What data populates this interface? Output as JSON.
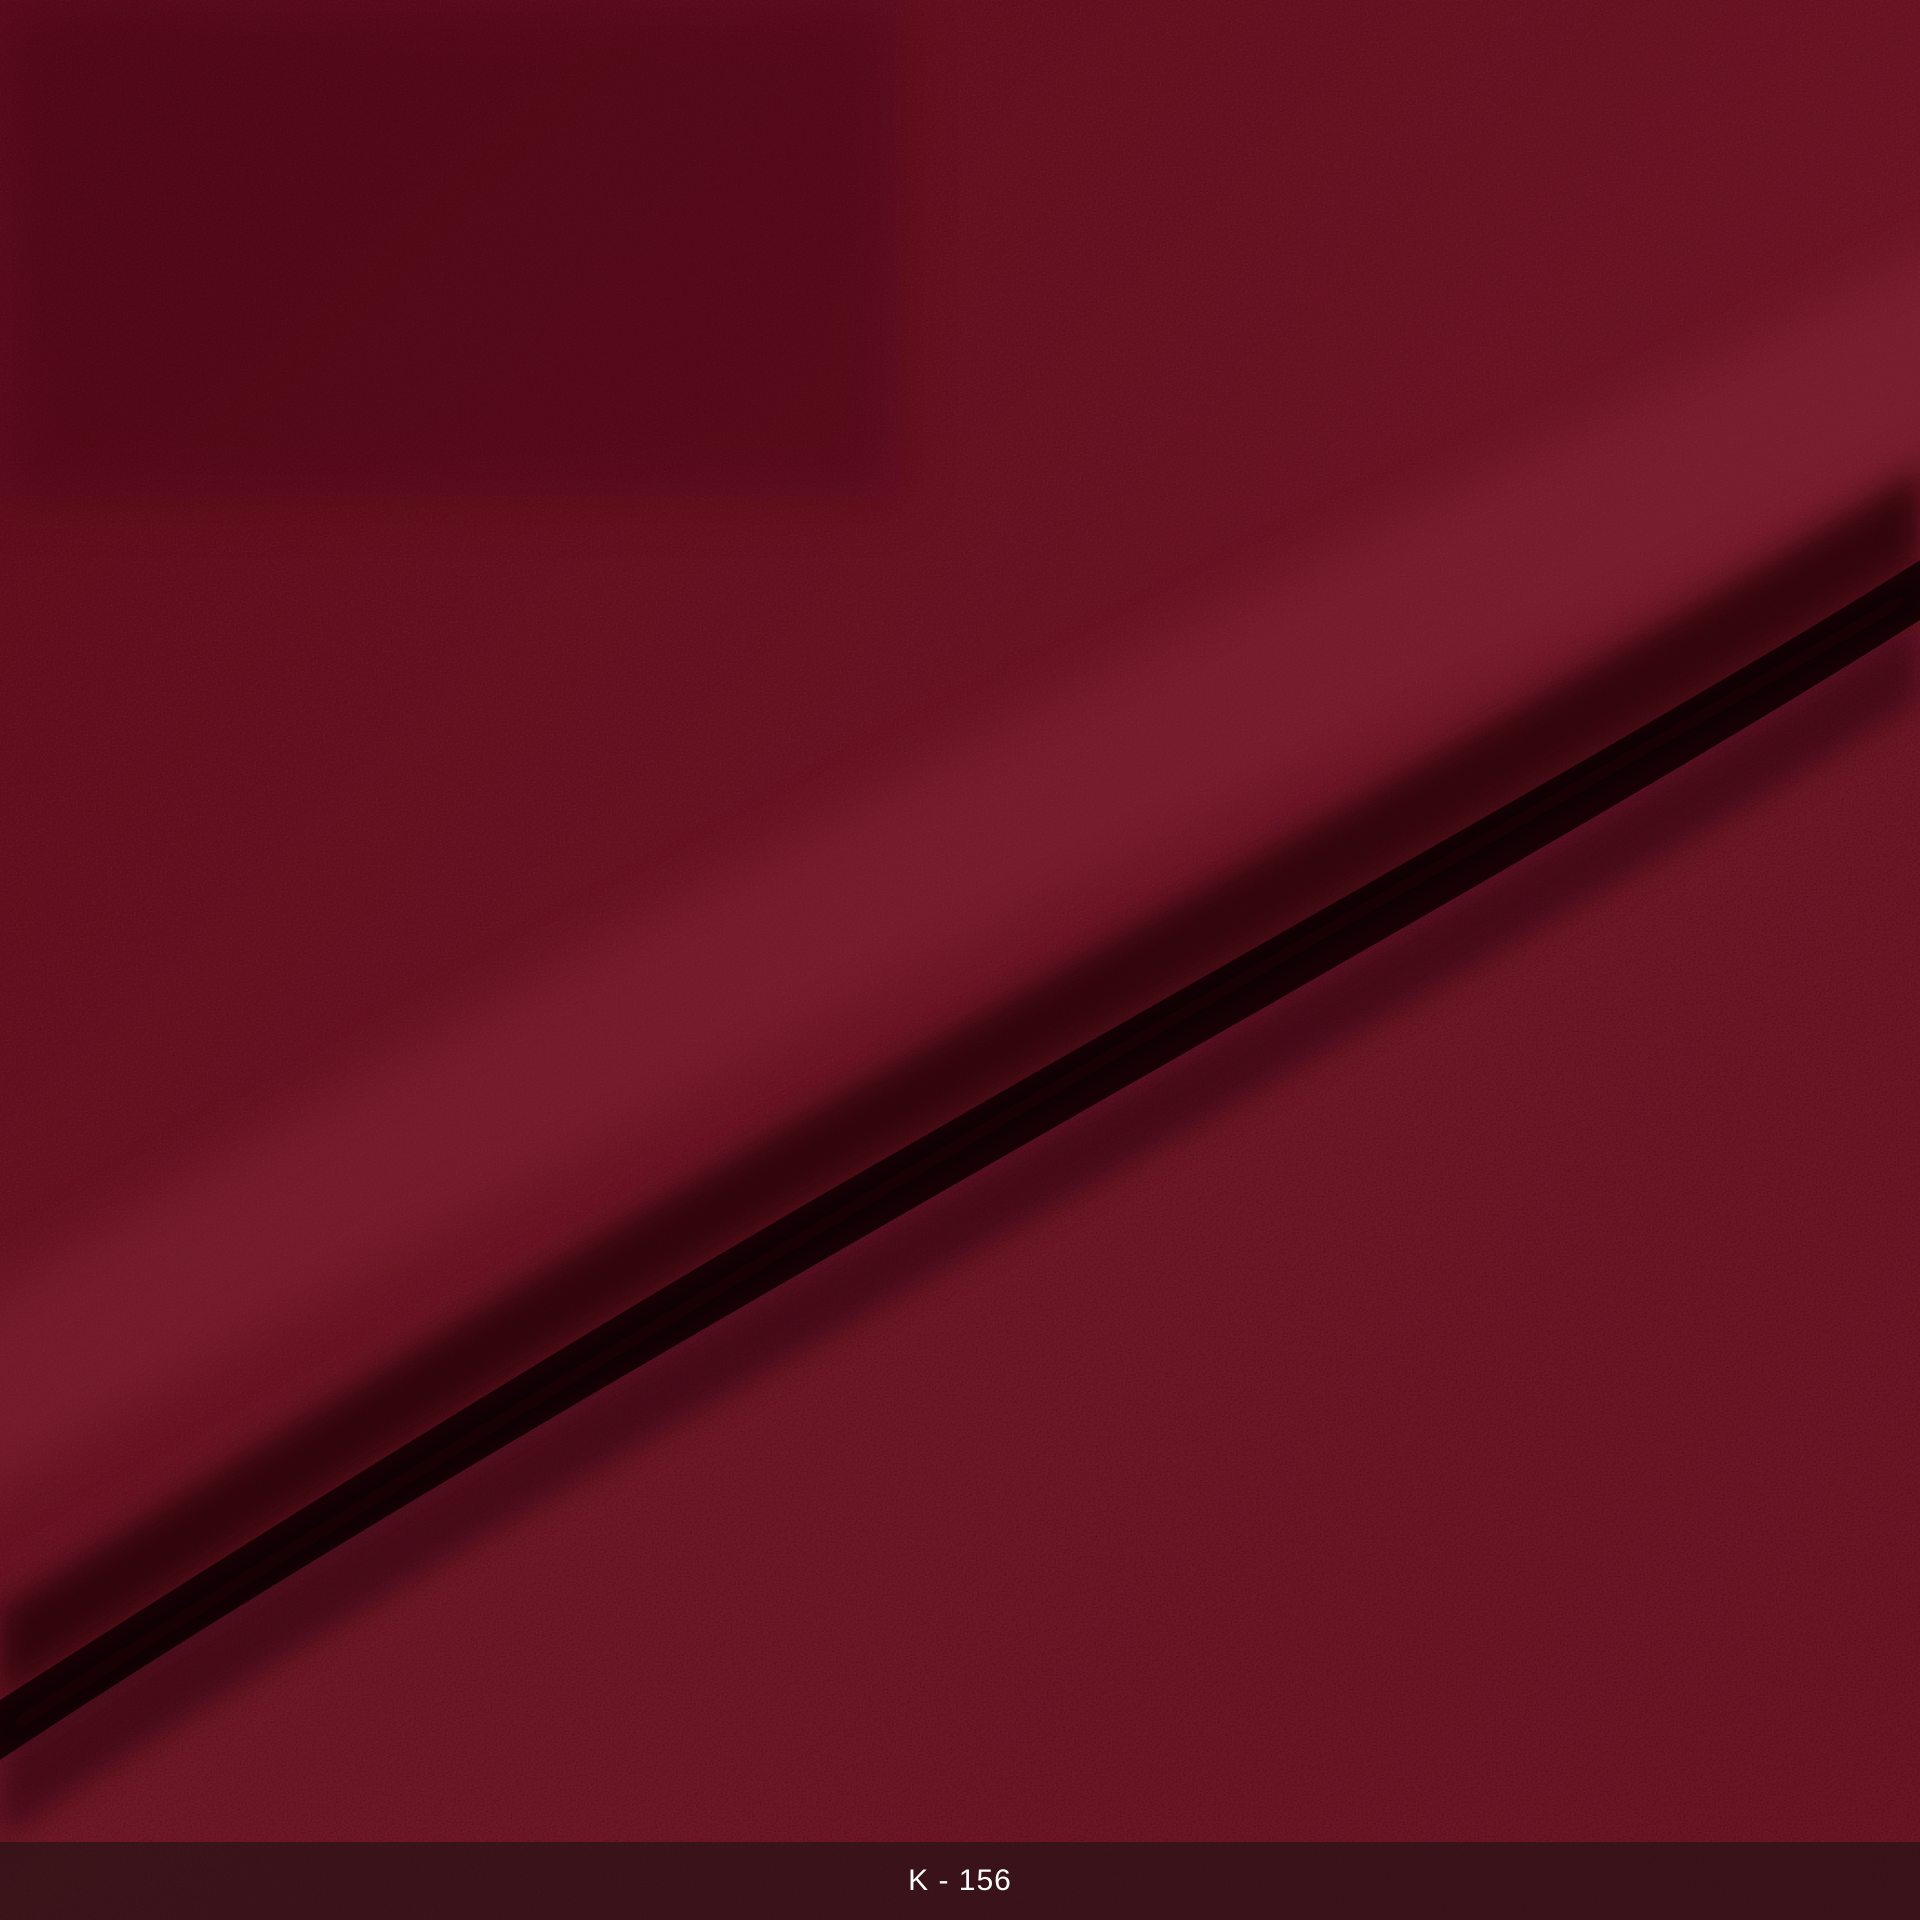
{
  "image": {
    "subject": "burgundy-leather-swatch",
    "colors": {
      "base": "#6e1424",
      "highlight": "#8c2a3a",
      "shadow": "#2a0209",
      "deep_shadow": "#140004"
    }
  },
  "caption": {
    "text": "K - 156"
  }
}
